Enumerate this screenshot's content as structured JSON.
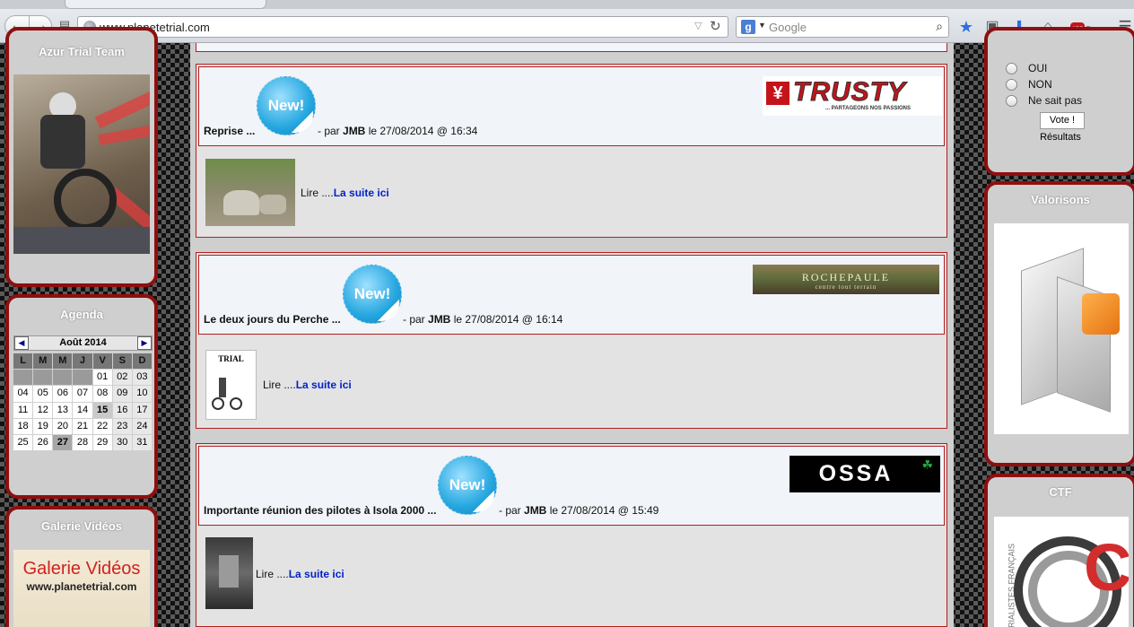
{
  "browser": {
    "url": "www.planetetrial.com",
    "search_placeholder": "Google",
    "abp_label": "ABP"
  },
  "left": {
    "azur_title": "Azur Trial Team",
    "agenda_title": "Agenda",
    "calendar": {
      "month": "Août 2014",
      "prev": "◀",
      "next": "▶",
      "dow": [
        "L",
        "M",
        "M",
        "J",
        "V",
        "S",
        "D"
      ],
      "weeks": [
        [
          "",
          "",
          "",
          "",
          "01",
          "02",
          "03"
        ],
        [
          "04",
          "05",
          "06",
          "07",
          "08",
          "09",
          "10"
        ],
        [
          "11",
          "12",
          "13",
          "14",
          "15",
          "16",
          "17"
        ],
        [
          "18",
          "19",
          "20",
          "21",
          "22",
          "23",
          "24"
        ],
        [
          "25",
          "26",
          "27",
          "28",
          "29",
          "30",
          "31"
        ]
      ],
      "highlight": "15",
      "today": "27"
    },
    "galerie_title": "Galerie Vidéos",
    "galerie_image_title": "Galerie Vidéos",
    "galerie_image_url": "www.planetetrial.com"
  },
  "right": {
    "poll": {
      "options": [
        "OUI",
        "NON",
        "Ne sait pas"
      ],
      "vote_label": "Vote !",
      "results_label": "Résultats"
    },
    "valorisons_title": "Valorisons",
    "ctf_title": "CTF",
    "ctf_side_text": "TRIALISTES FRANÇAIS",
    "ctf_logo_text": "CTF"
  },
  "articles": [
    {
      "title": "Reprise ...",
      "new_label": "New!",
      "by": " - par ",
      "author": "JMB",
      "date": " le 27/08/2014 @ 16:34",
      "logo_text": "TRUSTY",
      "logo_sub": "... PARTAGEONS NOS PASSIONS",
      "lire": "Lire ....",
      "link": "La suite ici"
    },
    {
      "title": "Le deux jours du Perche ...",
      "new_label": "New!",
      "by": " - par ",
      "author": "JMB",
      "date": " le 27/08/2014 @ 16:14",
      "logo_text": "ROCHEPAULE",
      "logo_sub": "centre tout terrain",
      "thumb_title": "TRIAL",
      "lire": "Lire ....",
      "link": "La suite ici"
    },
    {
      "title": "Importante réunion des pilotes à Isola 2000 ...",
      "new_label": "New!",
      "by": " - par ",
      "author": "JMB",
      "date": " le 27/08/2014 @ 15:49",
      "logo_text": "OSSA",
      "logo_mark": "☘",
      "lire": "Lire ....",
      "link": "La suite ici"
    }
  ]
}
